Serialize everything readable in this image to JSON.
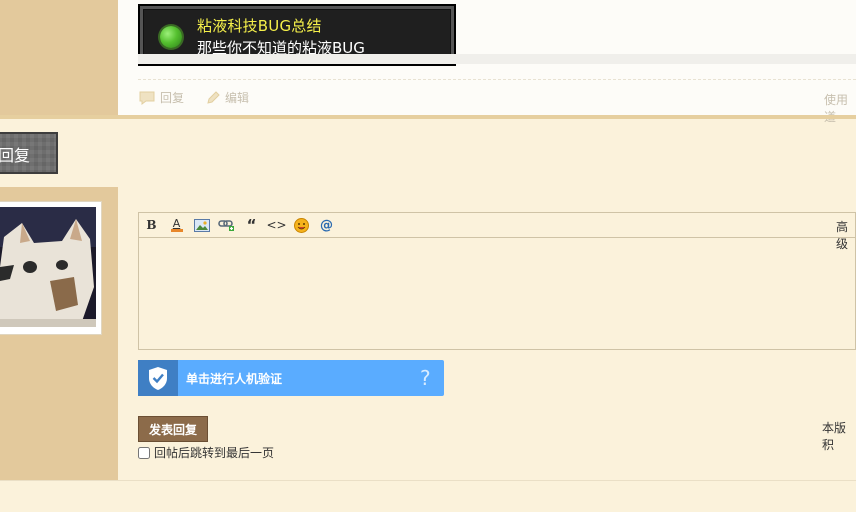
{
  "advancement": {
    "title": "粘液科技BUG总结",
    "subtitle": "那些你不知道的粘液BUG"
  },
  "post_actions": {
    "reply_label": "回复",
    "edit_label": "编辑",
    "usage_label": "使用道"
  },
  "reply_section": {
    "banner_label": "回复"
  },
  "editor": {
    "toolbar": {
      "bold_label": "B",
      "color_label": "A",
      "quote_label": "“",
      "code_label": "<>",
      "at_label": "@",
      "advanced_label": "高级"
    },
    "content": ""
  },
  "captcha": {
    "label": "单击进行人机验证",
    "help_label": "?"
  },
  "submit": {
    "button_label": "发表回复",
    "jump_label": "回帖后跳转到最后一页",
    "jump_checked": false,
    "board_note": "本版积"
  },
  "colors": {
    "background": "#fbf2db",
    "sidebar": "#e3c99c",
    "adv_title": "#f5f04a",
    "captcha": "#5aacff",
    "submit": "#8c6b4a"
  }
}
